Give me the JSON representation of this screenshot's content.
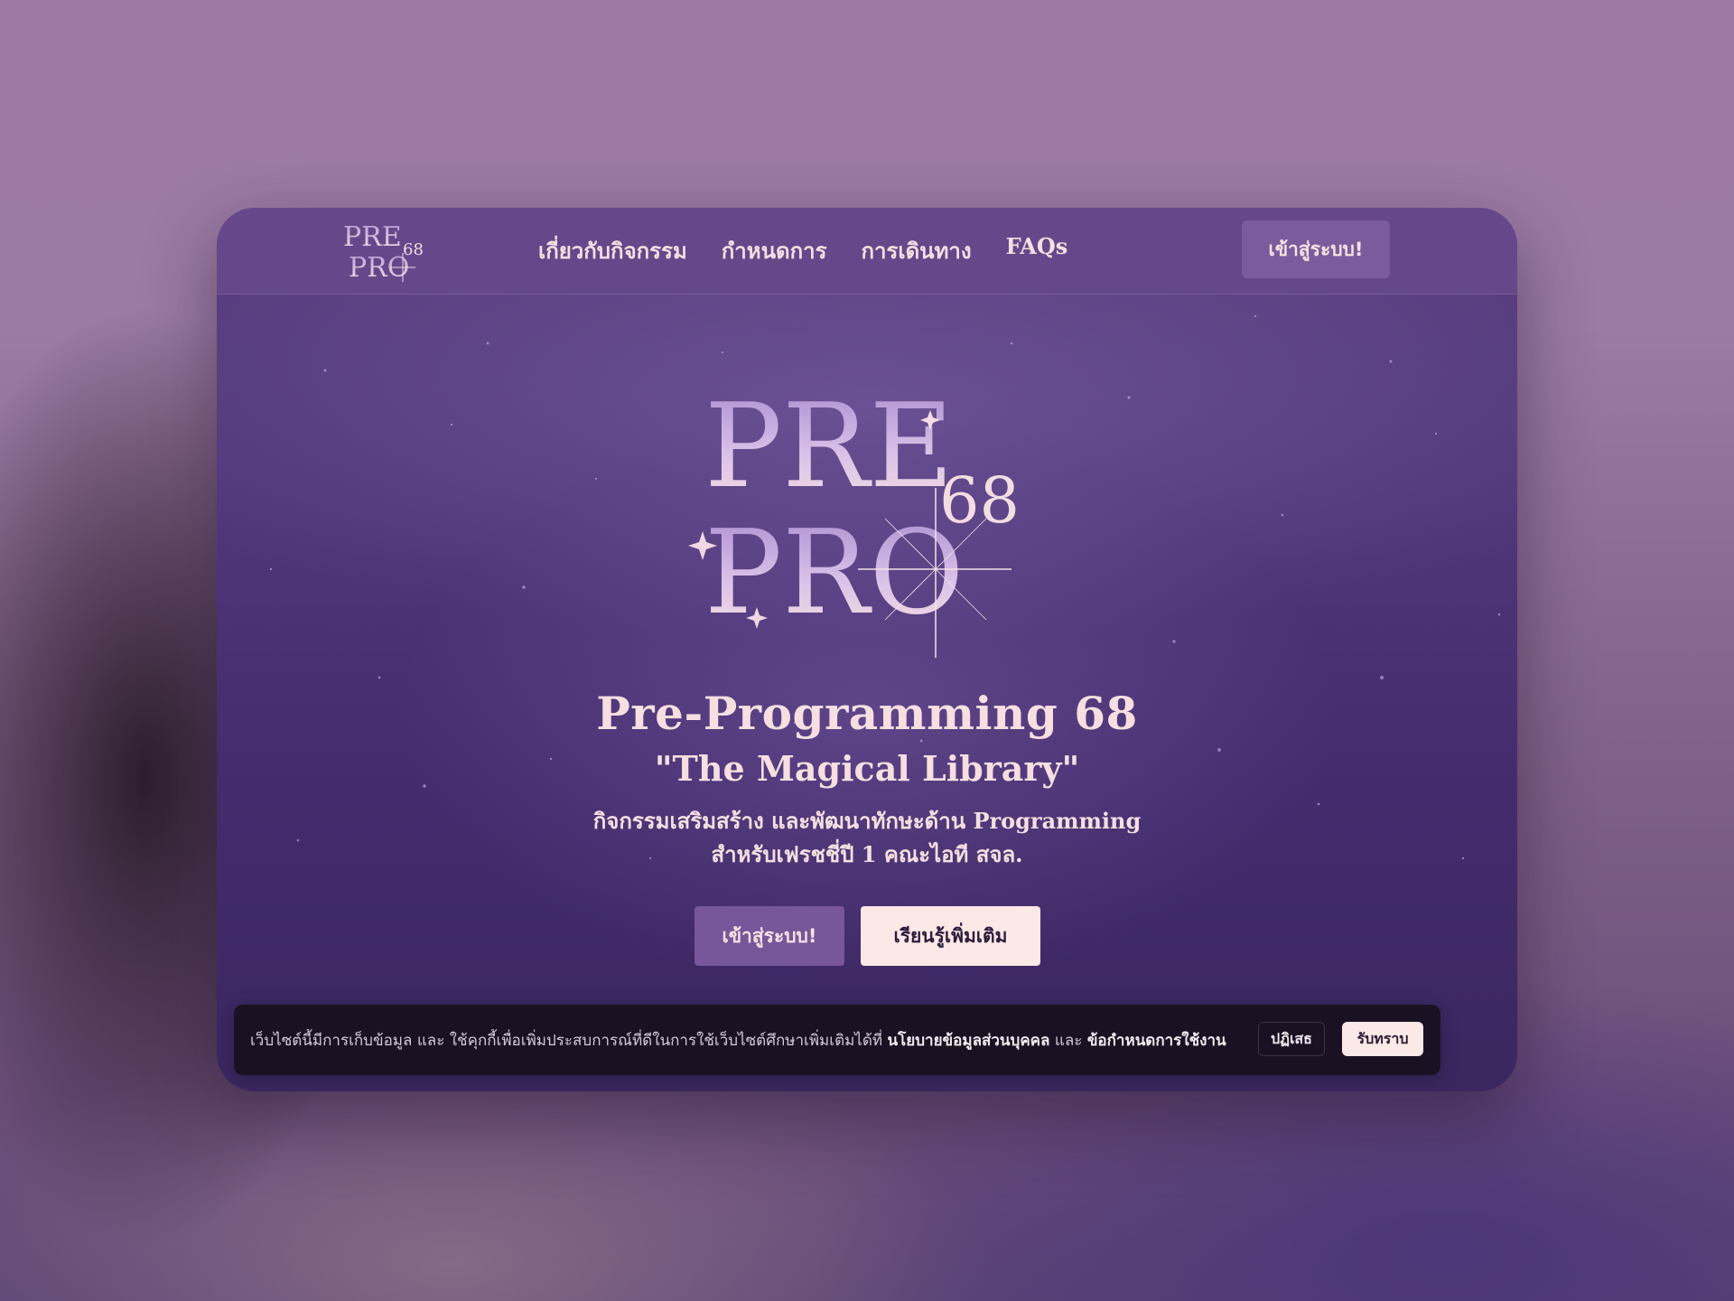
{
  "nav": {
    "logo_alt": "PRE PRO 68",
    "links": [
      {
        "label": "เกี่ยวกับกิจกรรม"
      },
      {
        "label": "กำหนดการ"
      },
      {
        "label": "การเดินทาง"
      },
      {
        "label": "FAQs"
      }
    ],
    "login_label": "เข้าสู่ระบบ!"
  },
  "hero": {
    "logo_text_top": "PRE",
    "logo_text_num": "68",
    "logo_text_bottom": "PRO",
    "title": "Pre-Programming 68",
    "subtitle": "\"The Magical Library\"",
    "description_line1": "กิจกรรมเสริมสร้าง และพัฒนาทักษะด้าน Programming",
    "description_line2": "สำหรับเฟรชชี่ปี 1 คณะไอที สจล.",
    "primary_button": "เข้าสู่ระบบ!",
    "secondary_button": "เรียนรู้เพิ่มเติม"
  },
  "cookie": {
    "text": "เว็บไซต์นี้มีการเก็บข้อมูล และ ใช้คุกกี้เพื่อเพิ่มประสบการณ์ที่ดีในการใช้เว็บไซต์ศึกษาเพิ่มเติมได้ที่ ",
    "privacy_link": "นโยบายข้อมูลส่วนบุคคล",
    "and": " และ ",
    "terms_link": "ข้อกำหนดการใช้งาน",
    "decline_label": "ปฏิเสธ",
    "accept_label": "รับทราบ"
  },
  "colors": {
    "nav_bg": "#66478a",
    "hero_bg": "#4e3679",
    "text_light": "#f5dfe0",
    "button_primary": "#775699",
    "button_secondary": "#fce8e6",
    "cookie_bg": "#1a1222"
  }
}
